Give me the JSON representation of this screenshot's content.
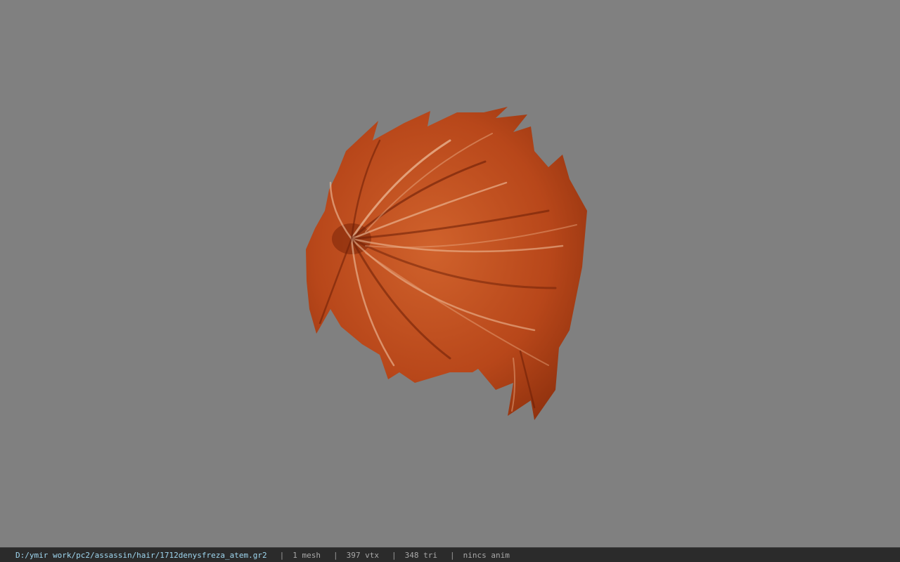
{
  "viewer": {
    "background_color": "#808080",
    "model_color": "#c4501a",
    "model_icon": "hair-mesh-model"
  },
  "status": {
    "path": "D:/ymir work/pc2/assassin/hair/1712denysfreza_atem.gr2",
    "separator": "|",
    "mesh": "1 mesh",
    "vtx": "397 vtx",
    "tri": "348 tri",
    "anim": "nincs anim"
  }
}
